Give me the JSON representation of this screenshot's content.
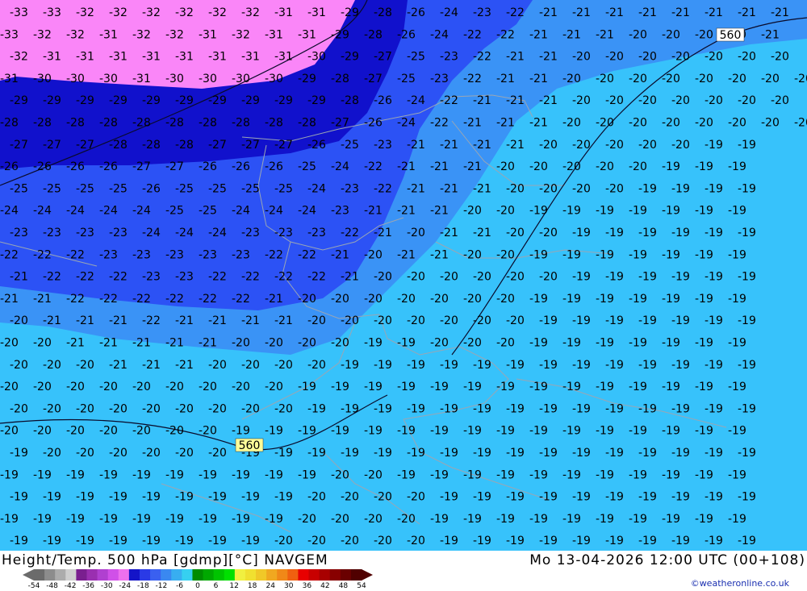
{
  "title": {
    "left": "Height/Temp. 500 hPa [gdmp][°C] NAVGEM",
    "right": "Mo 13-04-2026 12:00 UTC (00+108)"
  },
  "credit": "©weatheronline.co.uk",
  "colorbar": {
    "labels": [
      "-54",
      "-48",
      "-42",
      "-36",
      "-30",
      "-24",
      "-18",
      "-12",
      "-6",
      "0",
      "6",
      "12",
      "18",
      "24",
      "30",
      "36",
      "42",
      "48",
      "54"
    ],
    "colors": [
      "#6b6b6b",
      "#8c8c8c",
      "#acacac",
      "#cfcfcf",
      "#7a1f8f",
      "#9a2fb0",
      "#b040d0",
      "#d050e8",
      "#ee70ee",
      "#1414c8",
      "#2a3ae6",
      "#3a60f0",
      "#3a88f0",
      "#38aef0",
      "#36d0f0",
      "#008c00",
      "#00a800",
      "#00c400",
      "#00e000",
      "#f0f040",
      "#f0e030",
      "#f0c828",
      "#f0a820",
      "#f08818",
      "#f06010",
      "#e80000",
      "#c80000",
      "#a80000",
      "#880000",
      "#6a0000",
      "#500000"
    ]
  },
  "map": {
    "colors": {
      "pink": "#fa86f8",
      "navy": "#1111cc",
      "blue": "#2c52f5",
      "mid": "#3a93f6",
      "cyan": "#37c2fb",
      "contour": "#0a0a2a",
      "border": "#9aa6b4"
    },
    "isoline_labels": [
      {
        "text": "560",
        "lon_note": "upper-right contour"
      },
      {
        "text": "560",
        "lon_note": "lower-left contour"
      }
    ],
    "rows": [
      [
        "-33",
        "-33",
        "-32",
        "-32",
        "-32",
        "-32",
        "-32",
        "-32",
        "-31",
        "-31",
        "-29",
        "-28",
        "-26",
        "-24",
        "-23",
        "-22",
        "-21",
        "-21",
        "-21",
        "-21",
        "-21",
        "-21",
        "-21",
        "-21",
        "-21"
      ],
      [
        "-33",
        "-32",
        "-32",
        "-31",
        "-32",
        "-32",
        "-31",
        "-32",
        "-31",
        "-31",
        "-29",
        "-28",
        "-26",
        "-24",
        "-22",
        "-22",
        "-21",
        "-21",
        "-21",
        "-20",
        "-20",
        "-20",
        "-20",
        "-21"
      ],
      [
        "-32",
        "-31",
        "-31",
        "-31",
        "-31",
        "-31",
        "-31",
        "-31",
        "-31",
        "-30",
        "-29",
        "-27",
        "-25",
        "-23",
        "-22",
        "-21",
        "-21",
        "-20",
        "-20",
        "-20",
        "-20",
        "-20",
        "-20",
        "-20"
      ],
      [
        "-31",
        "-30",
        "-30",
        "-30",
        "-31",
        "-30",
        "-30",
        "-30",
        "-30",
        "-29",
        "-28",
        "-27",
        "-25",
        "-23",
        "-22",
        "-21",
        "-21",
        "-20",
        "-20",
        "-20",
        "-20",
        "-20",
        "-20",
        "-20",
        "-20"
      ],
      [
        "-29",
        "-29",
        "-29",
        "-29",
        "-29",
        "-29",
        "-29",
        "-29",
        "-29",
        "-29",
        "-28",
        "-26",
        "-24",
        "-22",
        "-21",
        "-21",
        "-21",
        "-20",
        "-20",
        "-20",
        "-20",
        "-20",
        "-20",
        "-20",
        "-20"
      ],
      [
        "-28",
        "-28",
        "-28",
        "-28",
        "-28",
        "-28",
        "-28",
        "-28",
        "-28",
        "-28",
        "-27",
        "-26",
        "-24",
        "-22",
        "-21",
        "-21",
        "-21",
        "-20",
        "-20",
        "-20",
        "-20",
        "-20",
        "-20",
        "-20",
        "-20"
      ],
      [
        "-27",
        "-27",
        "-27",
        "-28",
        "-28",
        "-28",
        "-27",
        "-27",
        "-27",
        "-26",
        "-25",
        "-23",
        "-21",
        "-21",
        "-21",
        "-21",
        "-20",
        "-20",
        "-20",
        "-20",
        "-20",
        "-19",
        "-19"
      ],
      [
        "-26",
        "-26",
        "-26",
        "-26",
        "-27",
        "-27",
        "-26",
        "-26",
        "-26",
        "-25",
        "-24",
        "-22",
        "-21",
        "-21",
        "-21",
        "-20",
        "-20",
        "-20",
        "-20",
        "-20",
        "-19",
        "-19",
        "-19"
      ],
      [
        "-25",
        "-25",
        "-25",
        "-25",
        "-26",
        "-25",
        "-25",
        "-25",
        "-25",
        "-24",
        "-23",
        "-22",
        "-21",
        "-21",
        "-21",
        "-20",
        "-20",
        "-20",
        "-20",
        "-19",
        "-19",
        "-19",
        "-19"
      ],
      [
        "-24",
        "-24",
        "-24",
        "-24",
        "-24",
        "-25",
        "-25",
        "-24",
        "-24",
        "-24",
        "-23",
        "-21",
        "-21",
        "-21",
        "-20",
        "-20",
        "-19",
        "-19",
        "-19",
        "-19",
        "-19",
        "-19",
        "-19"
      ],
      [
        "-23",
        "-23",
        "-23",
        "-23",
        "-24",
        "-24",
        "-24",
        "-23",
        "-23",
        "-23",
        "-22",
        "-21",
        "-20",
        "-21",
        "-21",
        "-20",
        "-20",
        "-19",
        "-19",
        "-19",
        "-19",
        "-19",
        "-19"
      ],
      [
        "-22",
        "-22",
        "-22",
        "-23",
        "-23",
        "-23",
        "-23",
        "-23",
        "-22",
        "-22",
        "-21",
        "-20",
        "-21",
        "-21",
        "-20",
        "-20",
        "-19",
        "-19",
        "-19",
        "-19",
        "-19",
        "-19",
        "-19"
      ],
      [
        "-21",
        "-22",
        "-22",
        "-22",
        "-23",
        "-23",
        "-22",
        "-22",
        "-22",
        "-22",
        "-21",
        "-20",
        "-20",
        "-20",
        "-20",
        "-20",
        "-20",
        "-19",
        "-19",
        "-19",
        "-19",
        "-19",
        "-19"
      ],
      [
        "-21",
        "-21",
        "-22",
        "-22",
        "-22",
        "-22",
        "-22",
        "-22",
        "-21",
        "-20",
        "-20",
        "-20",
        "-20",
        "-20",
        "-20",
        "-20",
        "-19",
        "-19",
        "-19",
        "-19",
        "-19",
        "-19",
        "-19"
      ],
      [
        "-20",
        "-21",
        "-21",
        "-21",
        "-22",
        "-21",
        "-21",
        "-21",
        "-21",
        "-20",
        "-20",
        "-20",
        "-20",
        "-20",
        "-20",
        "-20",
        "-19",
        "-19",
        "-19",
        "-19",
        "-19",
        "-19",
        "-19"
      ],
      [
        "-20",
        "-20",
        "-21",
        "-21",
        "-21",
        "-21",
        "-21",
        "-20",
        "-20",
        "-20",
        "-20",
        "-19",
        "-19",
        "-20",
        "-20",
        "-20",
        "-19",
        "-19",
        "-19",
        "-19",
        "-19",
        "-19",
        "-19"
      ],
      [
        "-20",
        "-20",
        "-20",
        "-21",
        "-21",
        "-21",
        "-20",
        "-20",
        "-20",
        "-20",
        "-19",
        "-19",
        "-19",
        "-19",
        "-19",
        "-19",
        "-19",
        "-19",
        "-19",
        "-19",
        "-19",
        "-19",
        "-19"
      ],
      [
        "-20",
        "-20",
        "-20",
        "-20",
        "-20",
        "-20",
        "-20",
        "-20",
        "-20",
        "-19",
        "-19",
        "-19",
        "-19",
        "-19",
        "-19",
        "-19",
        "-19",
        "-19",
        "-19",
        "-19",
        "-19",
        "-19",
        "-19"
      ],
      [
        "-20",
        "-20",
        "-20",
        "-20",
        "-20",
        "-20",
        "-20",
        "-20",
        "-20",
        "-19",
        "-19",
        "-19",
        "-19",
        "-19",
        "-19",
        "-19",
        "-19",
        "-19",
        "-19",
        "-19",
        "-19",
        "-19",
        "-19"
      ],
      [
        "-20",
        "-20",
        "-20",
        "-20",
        "-20",
        "-20",
        "-20",
        "-19",
        "-19",
        "-19",
        "-19",
        "-19",
        "-19",
        "-19",
        "-19",
        "-19",
        "-19",
        "-19",
        "-19",
        "-19",
        "-19",
        "-19",
        "-19"
      ],
      [
        "-19",
        "-20",
        "-20",
        "-20",
        "-20",
        "-20",
        "-20",
        "-19",
        "-19",
        "-19",
        "-19",
        "-19",
        "-19",
        "-19",
        "-19",
        "-19",
        "-19",
        "-19",
        "-19",
        "-19",
        "-19",
        "-19",
        "-19"
      ],
      [
        "-19",
        "-19",
        "-19",
        "-19",
        "-19",
        "-19",
        "-19",
        "-19",
        "-19",
        "-19",
        "-20",
        "-20",
        "-19",
        "-19",
        "-19",
        "-19",
        "-19",
        "-19",
        "-19",
        "-19",
        "-19",
        "-19",
        "-19"
      ],
      [
        "-19",
        "-19",
        "-19",
        "-19",
        "-19",
        "-19",
        "-19",
        "-19",
        "-19",
        "-20",
        "-20",
        "-20",
        "-20",
        "-19",
        "-19",
        "-19",
        "-19",
        "-19",
        "-19",
        "-19",
        "-19",
        "-19",
        "-19"
      ],
      [
        "-19",
        "-19",
        "-19",
        "-19",
        "-19",
        "-19",
        "-19",
        "-19",
        "-19",
        "-20",
        "-20",
        "-20",
        "-20",
        "-19",
        "-19",
        "-19",
        "-19",
        "-19",
        "-19",
        "-19",
        "-19",
        "-19",
        "-19"
      ],
      [
        "-19",
        "-19",
        "-19",
        "-19",
        "-19",
        "-19",
        "-19",
        "-19",
        "-20",
        "-20",
        "-20",
        "-20",
        "-20",
        "-19",
        "-19",
        "-19",
        "-19",
        "-19",
        "-19",
        "-19",
        "-19",
        "-19",
        "-19"
      ]
    ]
  }
}
